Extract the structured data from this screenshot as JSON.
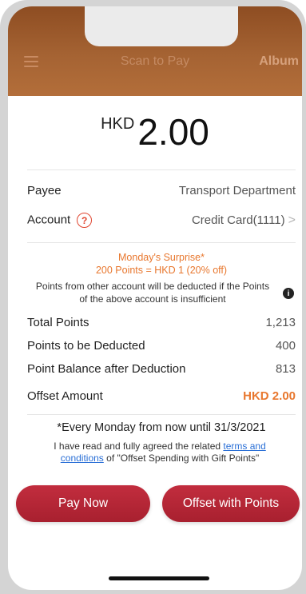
{
  "header": {
    "title": "Scan to Pay",
    "album_label": "Album"
  },
  "amount": {
    "currency": "HKD",
    "value": "2.00"
  },
  "payee": {
    "label": "Payee",
    "value": "Transport Department"
  },
  "account": {
    "label": "Account",
    "help_glyph": "?",
    "value": "Credit Card(1111)",
    "chevron": ">"
  },
  "promo": {
    "line1": "Monday's Surprise*",
    "line2": "200 Points = HKD 1 (20% off)"
  },
  "note": {
    "text": "Points from other account will be deducted if the Points of the above account is insufficient",
    "icon_glyph": "i"
  },
  "points": {
    "total_label": "Total Points",
    "total_value": "1,213",
    "deducted_label": "Points to be Deducted",
    "deducted_value": "400",
    "balance_label": "Point Balance after Deduction",
    "balance_value": "813",
    "offset_label": "Offset Amount",
    "offset_value": "HKD 2.00"
  },
  "footnote": "*Every Monday from now until 31/3/2021",
  "agreement": {
    "prefix": "I have read and fully agreed the related ",
    "link": "terms and conditions",
    "suffix": " of \"Offset Spending with Gift Points\""
  },
  "buttons": {
    "pay_now": "Pay Now",
    "offset": "Offset with Points"
  },
  "colors": {
    "accent_orange": "#e8772e",
    "button_red": "#b8263a",
    "header_brown": "#9b5a2c"
  }
}
